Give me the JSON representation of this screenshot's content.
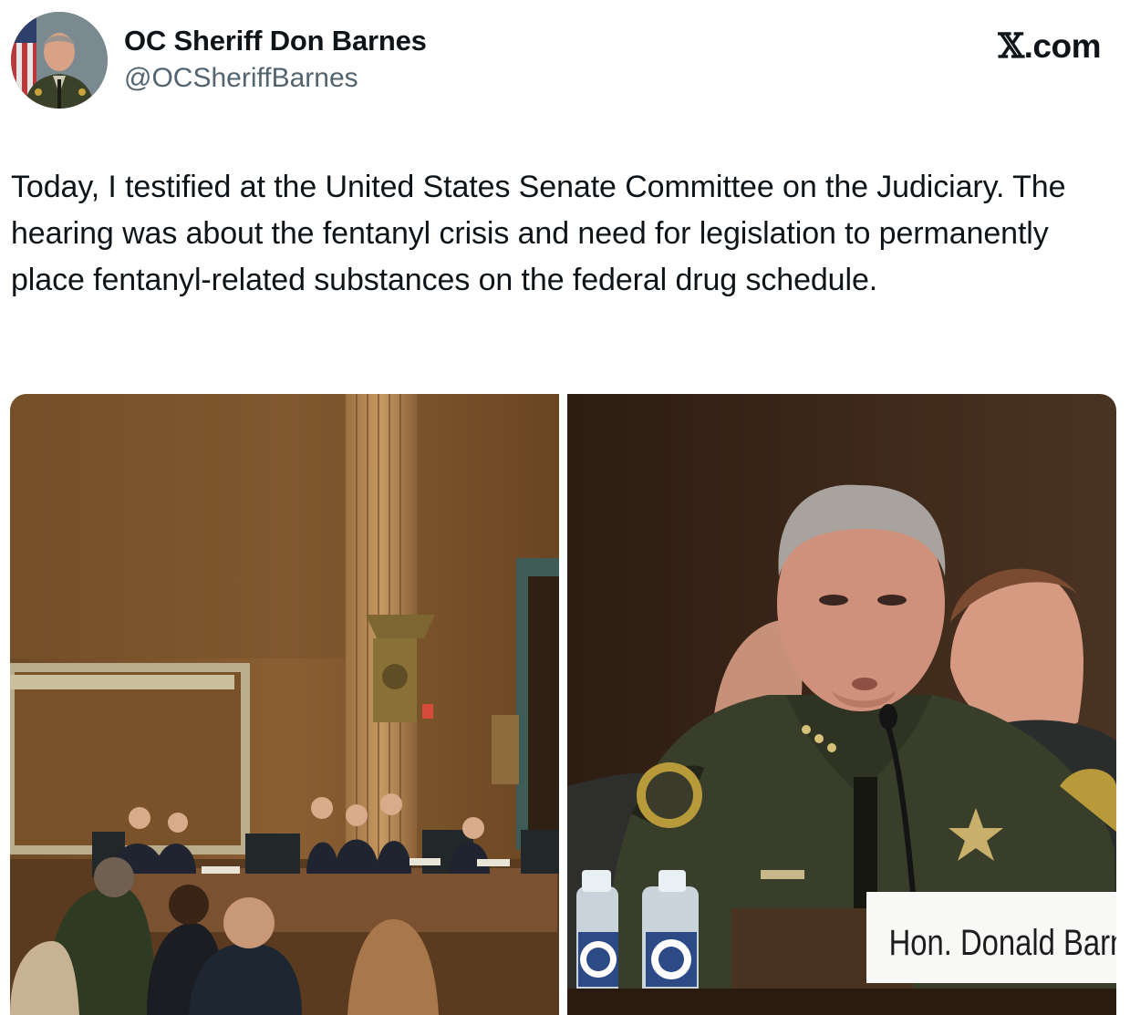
{
  "post": {
    "author_name": "OC Sheriff Don Barnes",
    "author_handle": "@OCSheriffBarnes",
    "brand": {
      "mark": "𝕏",
      "suffix": ".com"
    },
    "text": "Today, I testified at the United States Senate Committee on the Judiciary. The hearing was about the fentanyl crisis and need for legislation to permanently place fentanyl-related substances on the federal drug schedule."
  },
  "media": {
    "left_photo_icon": "senate-hearing-room-photo",
    "right_photo_icon": "testimony-closeup-photo",
    "nameplate": "Hon. Donald Barne"
  },
  "colors": {
    "text_primary": "#0f1419",
    "text_secondary": "#536471",
    "background": "#ffffff"
  }
}
